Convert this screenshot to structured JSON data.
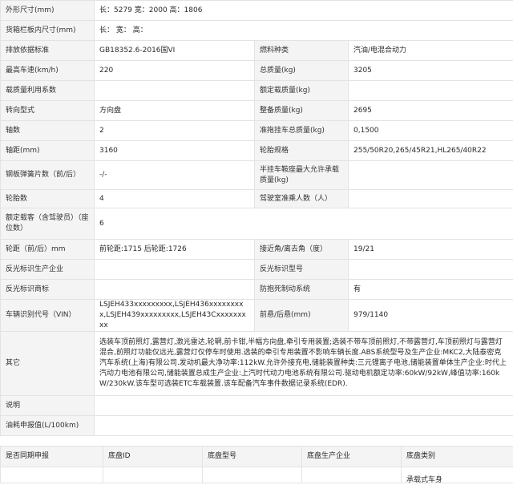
{
  "spec_rows": [
    {
      "cells": [
        {
          "text": "外形尺寸(mm)",
          "kind": "lbl"
        },
        {
          "text": "长：5279 宽：2000 高：1806",
          "kind": "val",
          "span": 3
        }
      ]
    },
    {
      "cells": [
        {
          "text": "货箱栏板内尺寸(mm)",
          "kind": "lbl"
        },
        {
          "text": "长： 宽： 高：",
          "kind": "val",
          "span": 3
        }
      ]
    },
    {
      "cells": [
        {
          "text": "排放依据标准",
          "kind": "lbl"
        },
        {
          "text": "GB18352.6-2016国VI",
          "kind": "val"
        },
        {
          "text": "燃料种类",
          "kind": "lbl"
        },
        {
          "text": "汽油/电混合动力",
          "kind": "val"
        }
      ]
    },
    {
      "cells": [
        {
          "text": "最高车速(km/h)",
          "kind": "lbl"
        },
        {
          "text": "220",
          "kind": "val"
        },
        {
          "text": "总质量(kg)",
          "kind": "lbl"
        },
        {
          "text": "3205",
          "kind": "val"
        }
      ]
    },
    {
      "cells": [
        {
          "text": "载质量利用系数",
          "kind": "lbl"
        },
        {
          "text": "",
          "kind": "val"
        },
        {
          "text": "额定载质量(kg)",
          "kind": "lbl"
        },
        {
          "text": "",
          "kind": "val"
        }
      ]
    },
    {
      "cells": [
        {
          "text": "转向型式",
          "kind": "lbl"
        },
        {
          "text": "方向盘",
          "kind": "val"
        },
        {
          "text": "整备质量(kg)",
          "kind": "lbl"
        },
        {
          "text": "2695",
          "kind": "val"
        }
      ]
    },
    {
      "cells": [
        {
          "text": "轴数",
          "kind": "lbl"
        },
        {
          "text": "2",
          "kind": "val"
        },
        {
          "text": "准拖挂车总质量(kg)",
          "kind": "lbl"
        },
        {
          "text": "0,1500",
          "kind": "val"
        }
      ]
    },
    {
      "cells": [
        {
          "text": "轴距(mm)",
          "kind": "lbl"
        },
        {
          "text": "3160",
          "kind": "val"
        },
        {
          "text": "轮胎规格",
          "kind": "lbl"
        },
        {
          "text": "255/50R20,265/45R21,HL265/40R22",
          "kind": "val"
        }
      ]
    },
    {
      "cells": [
        {
          "text": "钢板弹簧片数（前/后）",
          "kind": "lbl"
        },
        {
          "text": "-/-",
          "kind": "val"
        },
        {
          "text": "半挂车鞍座最大允许承载质量(kg)",
          "kind": "lbl"
        },
        {
          "text": "",
          "kind": "val"
        }
      ]
    },
    {
      "cells": [
        {
          "text": "轮胎数",
          "kind": "lbl"
        },
        {
          "text": "4",
          "kind": "val"
        },
        {
          "text": "驾驶室准乘人数（人）",
          "kind": "lbl"
        },
        {
          "text": "",
          "kind": "val"
        }
      ]
    },
    {
      "cells": [
        {
          "text": "额定载客（含驾驶员）（座位数）",
          "kind": "lbl"
        },
        {
          "text": "6",
          "kind": "val",
          "span": 3
        }
      ]
    },
    {
      "cells": [
        {
          "text": "轮距（前/后）mm",
          "kind": "lbl"
        },
        {
          "text": "前轮距:1715 后轮距:1726",
          "kind": "val"
        },
        {
          "text": "接近角/离去角（度）",
          "kind": "lbl"
        },
        {
          "text": "19/21",
          "kind": "val"
        }
      ]
    },
    {
      "cells": [
        {
          "text": "反光标识生产企业",
          "kind": "lbl"
        },
        {
          "text": "",
          "kind": "val"
        },
        {
          "text": "反光标识型号",
          "kind": "lbl"
        },
        {
          "text": "",
          "kind": "val"
        }
      ]
    },
    {
      "cells": [
        {
          "text": "反光标识商标",
          "kind": "lbl"
        },
        {
          "text": "",
          "kind": "val"
        },
        {
          "text": "防抱死制动系统",
          "kind": "lbl"
        },
        {
          "text": "有",
          "kind": "val"
        }
      ]
    },
    {
      "cells": [
        {
          "text": "车辆识别代号（VIN）",
          "kind": "lbl"
        },
        {
          "text": "LSJEH433xxxxxxxxx,LSJEH436xxxxxxxxx,LSJEH439xxxxxxxxx,LSJEH43Cxxxxxxxxx",
          "kind": "val"
        },
        {
          "text": "前悬/后悬(mm)",
          "kind": "lbl"
        },
        {
          "text": "979/1140",
          "kind": "val"
        }
      ]
    },
    {
      "cells": [
        {
          "text": "其它",
          "kind": "lbl"
        },
        {
          "text": "选装车顶前照灯,露营灯,激光雷达,轮辋,前卡钳,半幅方向盘,牵引专用装置;选装不带车顶前照灯,不带露营灯,车顶前照灯与露营灯混合,前照灯功能仅远光,露营灯仅停车时使用.选装的牵引专用装置不影响车辆长度.ABS系统型号及生产企业:MKC2,大陆泰密克汽车系统(上海)有限公司.发动机最大净功率:112kW.允许外接充电,储能装置种类:三元锂离子电池,储能装置单体生产企业:时代上汽动力电池有限公司,储能装置总成生产企业:上汽时代动力电池系统有限公司.驱动电机额定功率:60kW/92kW,峰值功率:160kW/230kW.该车型可选装ETC车载装置.该车配备汽车事件数据记录系统(EDR).",
          "kind": "val",
          "span": 3
        }
      ]
    },
    {
      "cells": [
        {
          "text": "说明",
          "kind": "lbl"
        },
        {
          "text": "",
          "kind": "val",
          "span": 3
        }
      ]
    },
    {
      "cells": [
        {
          "text": "油耗申报值(L/100km)",
          "kind": "lbl"
        },
        {
          "text": "",
          "kind": "val",
          "span": 3
        }
      ]
    }
  ],
  "chassis": {
    "headers": [
      "是否同期申报",
      "底盘ID",
      "底盘型号",
      "底盘生产企业",
      "底盘类别"
    ],
    "partial_text": "承载式车身"
  }
}
